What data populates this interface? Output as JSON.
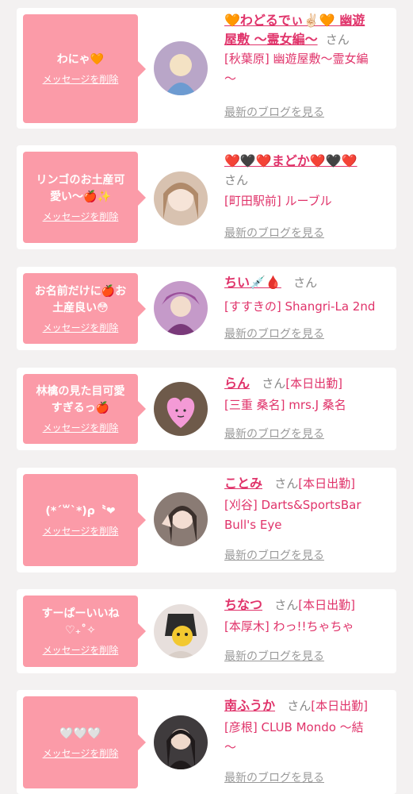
{
  "items": [
    {
      "message": "わにゃ🧡",
      "delete_label": "メッセージを削除",
      "name_lines": [
        "🧡わどるでぃ✌🏻🧡 幽遊",
        "屋敷 〜霊女編〜"
      ],
      "san": "さん",
      "status": "",
      "shop_lines": [
        "[秋葉原] 幽遊屋敷〜霊女編",
        "〜"
      ],
      "blog_label": "最新のブログを見る",
      "avatar_color": "#b9a6c8"
    },
    {
      "message": "リンゴのお土産可\n愛い〜🍎✨",
      "delete_label": "メッセージを削除",
      "name_lines": [
        "❤️🖤❤️まどか❤️🖤❤️"
      ],
      "san": "さん",
      "status": "",
      "shop_lines": [
        "[町田駅前] ルーブル"
      ],
      "blog_label": "最新のブログを見る",
      "avatar_color": "#d8c2b0"
    },
    {
      "message": "お名前だけに🍎お\n土産良い😳",
      "delete_label": "メッセージを削除",
      "name_lines": [
        "ちい💉🩸"
      ],
      "san": "さん",
      "status": "",
      "shop_lines": [
        "[すすきの] Shangri-La 2nd"
      ],
      "blog_label": "最新のブログを見る",
      "avatar_color": "#c59ac9"
    },
    {
      "message": "林檎の見た目可愛\nすぎるっ🍎",
      "delete_label": "メッセージを削除",
      "name_lines": [
        "らん"
      ],
      "san": "さん",
      "status": "[本日出勤]",
      "shop_lines": [
        "[三重 桑名] mrs.J 桑名"
      ],
      "blog_label": "最新のブログを見る",
      "avatar_color": "#6e5a4a"
    },
    {
      "message": "(*´꒳`*)ρ〝❤",
      "delete_label": "メッセージを削除",
      "name_lines": [
        "ことみ"
      ],
      "san": "さん",
      "status": "[本日出勤]",
      "shop_lines": [
        "[刈谷] Darts&SportsBar",
        "Bull's Eye"
      ],
      "blog_label": "最新のブログを見る",
      "avatar_color": "#8a7b74"
    },
    {
      "message": "すーぱーいいね\n♡₊˚✧",
      "delete_label": "メッセージを削除",
      "name_lines": [
        "ちなつ"
      ],
      "san": "さん",
      "status": "[本日出勤]",
      "shop_lines": [
        "[本厚木] わっ!!ちゃちゃ"
      ],
      "blog_label": "最新のブログを見る",
      "avatar_color": "#e7dfdc"
    },
    {
      "message": "🤍🤍🤍",
      "delete_label": "メッセージを削除",
      "name_lines": [
        "南ふうか"
      ],
      "san": "さん",
      "status": "[本日出勤]",
      "shop_lines": [
        "[彦根] CLUB Mondo 〜結",
        "〜"
      ],
      "blog_label": "最新のブログを見る",
      "avatar_color": "#3f3b3d"
    }
  ]
}
